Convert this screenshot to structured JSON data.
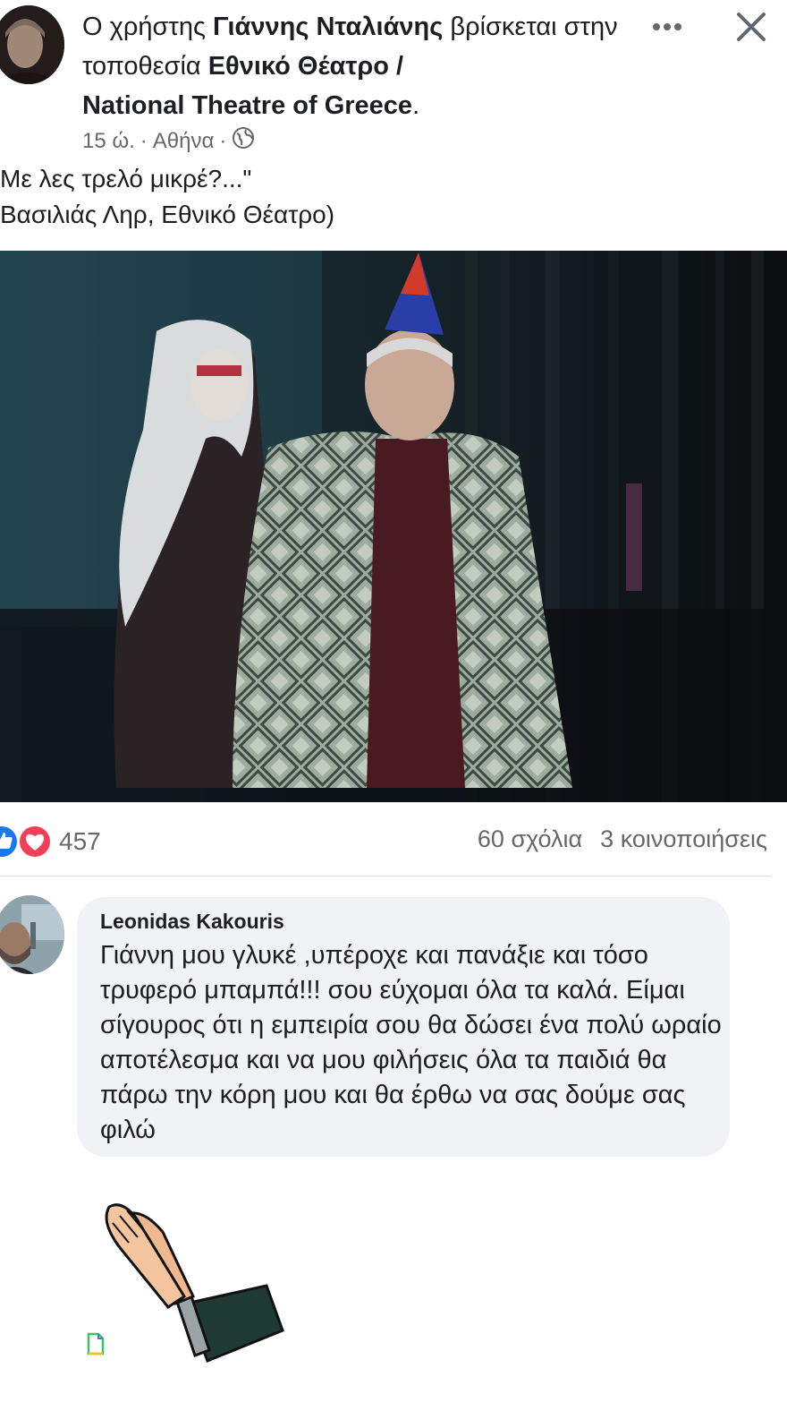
{
  "post": {
    "header_pre": "Ο χρήστης ",
    "author": "Γιάννης Νταλιάνης",
    "header_mid": " βρίσκεται στην τοποθεσία ",
    "location_line1": "Εθνικό Θέατρο /",
    "location_line2": "National Theatre of Greece",
    "header_end": ".",
    "time": "15 ώ.",
    "place": "Αθήνα",
    "sep": "·",
    "caption_line1": "Με λες τρελό μικρέ?...\"",
    "caption_line2": "Βασιλιάς Ληρ, Εθνικό Θέατρο)"
  },
  "reactions": {
    "count": "457",
    "comments": "60 σχόλια",
    "shares": "3 κοινοποιήσεις"
  },
  "comment": {
    "author": "Leonidas Kakouris",
    "text": "Γιάννη μου γλυκέ ,υπέροχε και πανάξιε και τόσο τρυφερό μπαμπά!!! σου εύχομαι όλα τα καλά. Είμαι σίγουρος ότι η εμπειρία σου θα δώσει ένα πολύ ωραίο αποτέλεσμα και να μου φιλήσεις όλα τα παιδιά θα πάρω την κόρη μου και θα έρθω να σας δούμε σας φιλώ"
  },
  "icons": {
    "more": "more-options-icon",
    "close": "close-icon",
    "globe": "globe-icon",
    "like": "like-reaction-icon",
    "love": "love-reaction-icon",
    "clap": "clapping-hands-sticker",
    "doc": "document-icon"
  },
  "colors": {
    "like_blue": "#1877f2",
    "love_red": "#f33e58",
    "secondary_text": "#65676b",
    "bubble_bg": "#f0f2f5"
  }
}
